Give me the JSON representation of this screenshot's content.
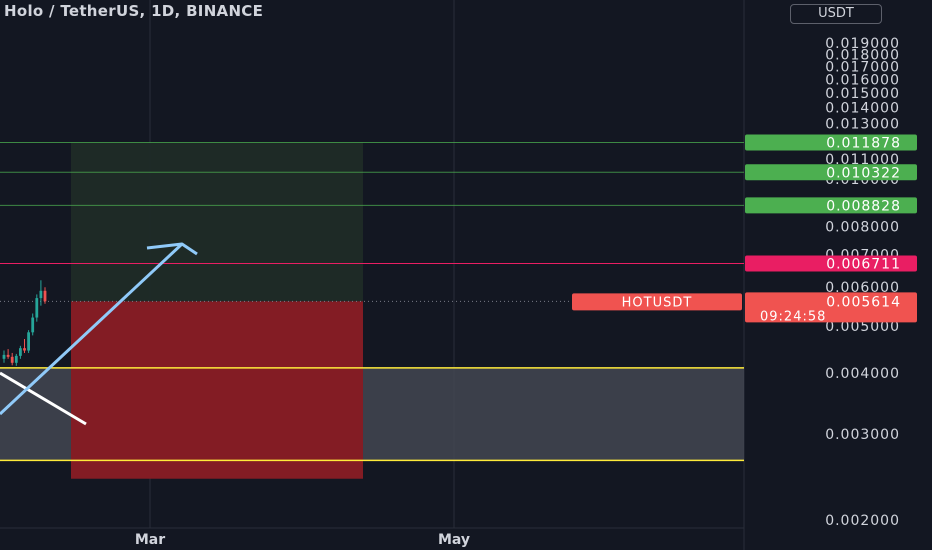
{
  "header": {
    "title": "Holo / TetherUS, 1D, BINANCE",
    "currency_badge": "USDT"
  },
  "colors": {
    "background": "#131722",
    "grid": "#2a2e39",
    "axis_text": "#d1d4dc",
    "target_line": "#4caf50",
    "entry_line": "#e91e63",
    "support_line": "#ffeb3b",
    "profit_zone": "#1f2b27",
    "loss_zone": "#831c24",
    "support_zone": "#434651",
    "arrow": "#90caf9",
    "trendline": "#ffffff",
    "price_tag": "#f05350",
    "candle_up": "#26a69a",
    "candle_down": "#ef5350"
  },
  "chart_data": {
    "type": "candlestick",
    "title": "Holo / TetherUS, 1D, BINANCE",
    "y_axis": {
      "scale": "log",
      "ticks": [
        "0.019000",
        "0.018000",
        "0.017000",
        "0.016000",
        "0.015000",
        "0.014000",
        "0.013000",
        "0.011000",
        "0.010000",
        "0.008000",
        "0.007000",
        "0.006000",
        "0.005000",
        "0.004000",
        "0.003000",
        "0.002000"
      ],
      "tick_values": [
        0.019,
        0.018,
        0.017,
        0.016,
        0.015,
        0.014,
        0.013,
        0.011,
        0.01,
        0.008,
        0.007,
        0.006,
        0.005,
        0.004,
        0.003,
        0.002
      ],
      "range": [
        0.00195,
        0.0205
      ]
    },
    "x_axis": {
      "ticks": [
        "Mar",
        "May"
      ]
    },
    "horizontal_levels": [
      {
        "role": "target",
        "value": 0.011878,
        "label": "0.011878"
      },
      {
        "role": "target",
        "value": 0.010322,
        "label": "0.010322"
      },
      {
        "role": "target",
        "value": 0.008828,
        "label": "0.008828"
      },
      {
        "role": "entry",
        "value": 0.006711,
        "label": "0.006711"
      },
      {
        "role": "support",
        "value": 0.0041
      },
      {
        "role": "support",
        "value": 0.00265
      }
    ],
    "last_price": {
      "symbol": "HOTUSDT",
      "value": 0.005614,
      "label": "0.005614",
      "countdown": "09:24:58"
    },
    "zones": [
      {
        "role": "profit",
        "from": 0.005614,
        "to": 0.011878
      },
      {
        "role": "loss",
        "from": 0.00243,
        "to": 0.005614
      },
      {
        "role": "support",
        "from": 0.00265,
        "to": 0.0041
      }
    ],
    "candles": [
      {
        "o": 0.00428,
        "h": 0.00445,
        "l": 0.0042,
        "c": 0.00436
      },
      {
        "o": 0.00436,
        "h": 0.00448,
        "l": 0.00428,
        "c": 0.00432
      },
      {
        "o": 0.00432,
        "h": 0.0044,
        "l": 0.00415,
        "c": 0.0042
      },
      {
        "o": 0.0042,
        "h": 0.00438,
        "l": 0.00414,
        "c": 0.00434
      },
      {
        "o": 0.00434,
        "h": 0.00455,
        "l": 0.00428,
        "c": 0.0045
      },
      {
        "o": 0.0045,
        "h": 0.0047,
        "l": 0.0044,
        "c": 0.00445
      },
      {
        "o": 0.00445,
        "h": 0.0049,
        "l": 0.0044,
        "c": 0.00485
      },
      {
        "o": 0.00485,
        "h": 0.0053,
        "l": 0.00478,
        "c": 0.0052
      },
      {
        "o": 0.0052,
        "h": 0.0058,
        "l": 0.0051,
        "c": 0.0057
      },
      {
        "o": 0.0057,
        "h": 0.0062,
        "l": 0.0055,
        "c": 0.0059
      },
      {
        "o": 0.0059,
        "h": 0.006,
        "l": 0.00555,
        "c": 0.005614
      }
    ]
  }
}
